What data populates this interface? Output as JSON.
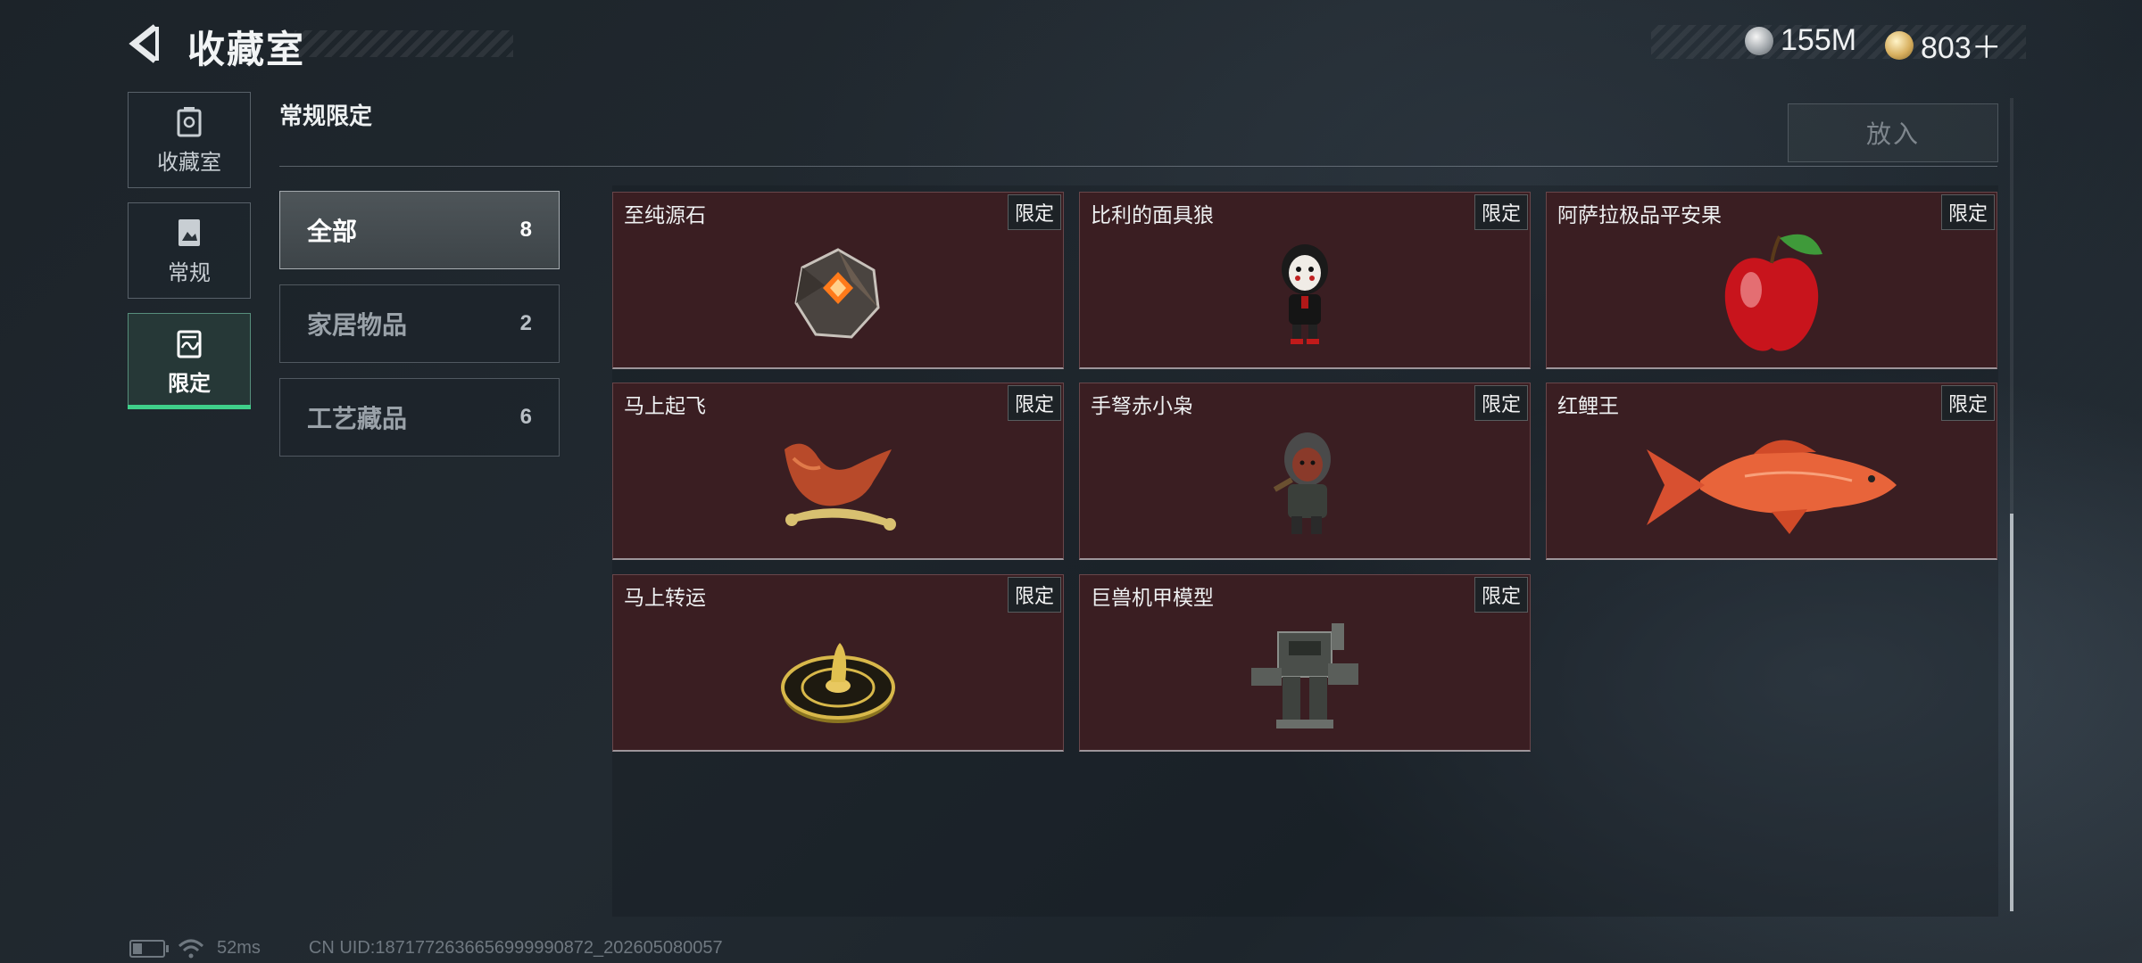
{
  "header": {
    "title": "收藏室",
    "currencies": [
      {
        "name": "silver-coin-icon",
        "value": "155M"
      },
      {
        "name": "gold-coin-icon",
        "value": "803＋"
      }
    ]
  },
  "side_nav": {
    "items": [
      {
        "label": "收藏室",
        "icon": "collection-room-icon",
        "active": false
      },
      {
        "label": "常规",
        "icon": "regular-icon",
        "active": false
      },
      {
        "label": "限定",
        "icon": "limited-icon",
        "active": true
      }
    ]
  },
  "main": {
    "section_title": "常规限定",
    "put_button_label": "放入",
    "categories": [
      {
        "label": "全部",
        "count": "8",
        "active": true
      },
      {
        "label": "家居物品",
        "count": "2",
        "active": false
      },
      {
        "label": "工艺藏品",
        "count": "6",
        "active": false
      }
    ],
    "items": [
      {
        "name": "至纯源石",
        "tag": "限定",
        "art": "crystal-stone-icon"
      },
      {
        "name": "比利的面具狼",
        "tag": "限定",
        "art": "masked-doll-icon"
      },
      {
        "name": "阿萨拉极品平安果",
        "tag": "限定",
        "art": "apple-icon"
      },
      {
        "name": "马上起飞",
        "tag": "限定",
        "art": "horse-statue-icon"
      },
      {
        "name": "手弩赤小枭",
        "tag": "限定",
        "art": "hooded-figure-icon"
      },
      {
        "name": "红鲤王",
        "tag": "限定",
        "art": "carp-fish-icon"
      },
      {
        "name": "马上转运",
        "tag": "限定",
        "art": "fortune-wheel-icon"
      },
      {
        "name": "巨兽机甲模型",
        "tag": "限定",
        "art": "mech-model-icon"
      }
    ]
  },
  "status": {
    "ping": "52ms",
    "uid": "CN UID:1871772636656999990872_202605080057"
  },
  "colors": {
    "accent_active": "#3fd08a",
    "card_bg": "#3a1e22",
    "background": "#1f272e"
  }
}
